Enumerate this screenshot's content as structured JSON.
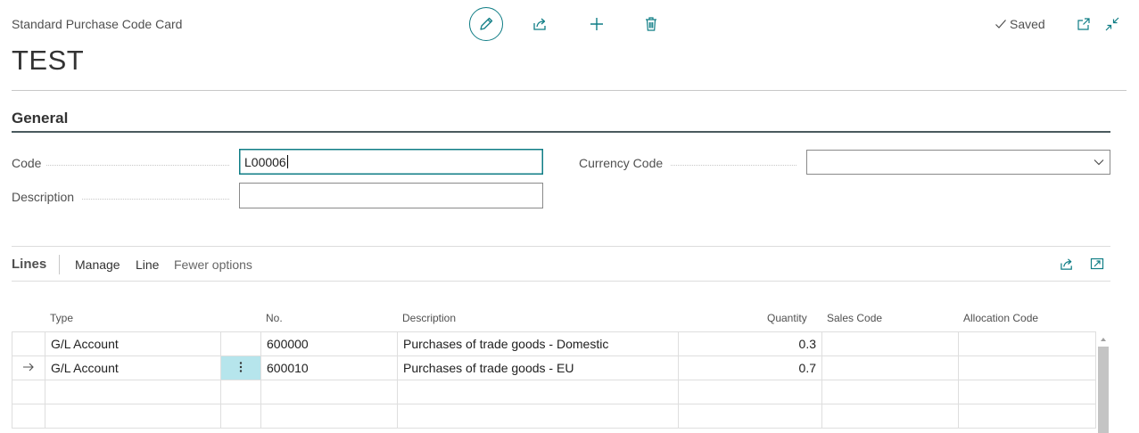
{
  "header": {
    "caption": "Standard Purchase Code Card",
    "title": "TEST",
    "status": "Saved"
  },
  "toolbar": {
    "icons": [
      "pencil-icon",
      "share-icon",
      "plus-icon",
      "trash-icon",
      "open-new-window-icon",
      "collapse-icon"
    ]
  },
  "general": {
    "title": "General",
    "code_label": "Code",
    "code_value": "L00006",
    "description_label": "Description",
    "description_value": "",
    "currency_label": "Currency Code",
    "currency_value": ""
  },
  "lines": {
    "title": "Lines",
    "actions": [
      "Manage",
      "Line",
      "Fewer options"
    ],
    "columns": {
      "type": "Type",
      "no": "No.",
      "description": "Description",
      "quantity": "Quantity",
      "sales_code": "Sales Code",
      "allocation_code": "Allocation Code"
    },
    "rows": [
      {
        "type": "G/L Account",
        "no": "600000",
        "description": "Purchases of trade goods - Domestic",
        "quantity": "0.3",
        "sales_code": "",
        "allocation_code": ""
      },
      {
        "type": "G/L Account",
        "no": "600010",
        "description": "Purchases of trade goods - EU",
        "quantity": "0.7",
        "sales_code": "",
        "allocation_code": ""
      },
      {
        "type": "",
        "no": "",
        "description": "",
        "quantity": "",
        "sales_code": "",
        "allocation_code": ""
      },
      {
        "type": "",
        "no": "",
        "description": "",
        "quantity": "",
        "sales_code": "",
        "allocation_code": ""
      }
    ]
  },
  "colors": {
    "accent": "#0f7d85",
    "selected_cell": "#b6e5ec"
  }
}
